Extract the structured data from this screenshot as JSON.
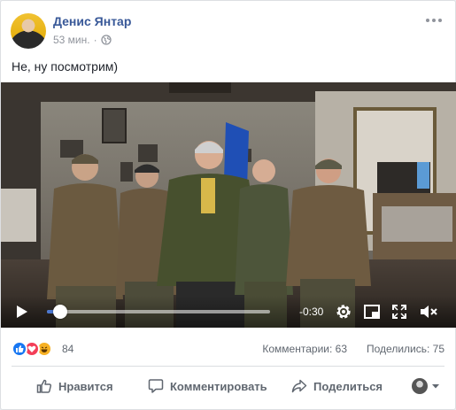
{
  "post": {
    "author": "Денис Янтар",
    "time": "53 мин.",
    "separator": "·",
    "audience_icon": "globe-icon",
    "text": "Не, ну посмотрим)"
  },
  "video": {
    "time_remaining": "-0:30",
    "progress": 0.06,
    "icons": [
      "play-icon",
      "settings-gear-icon",
      "picture-in-picture-icon",
      "fullscreen-icon",
      "volume-muted-icon"
    ]
  },
  "stats": {
    "reaction_icons": [
      "like-reaction-icon",
      "love-reaction-icon",
      "haha-reaction-icon"
    ],
    "reaction_count": "84",
    "comments": "Комментарии: 63",
    "shares": "Поделились: 75"
  },
  "actions": {
    "like": "Нравится",
    "comment": "Комментировать",
    "share": "Поделиться"
  },
  "colors": {
    "link": "#385898",
    "accent": "#4b77d1",
    "muted_text": "#606770",
    "meta_text": "#90949c",
    "like": "#1877f2",
    "love": "#f33e58",
    "haha": "#f7b125"
  }
}
